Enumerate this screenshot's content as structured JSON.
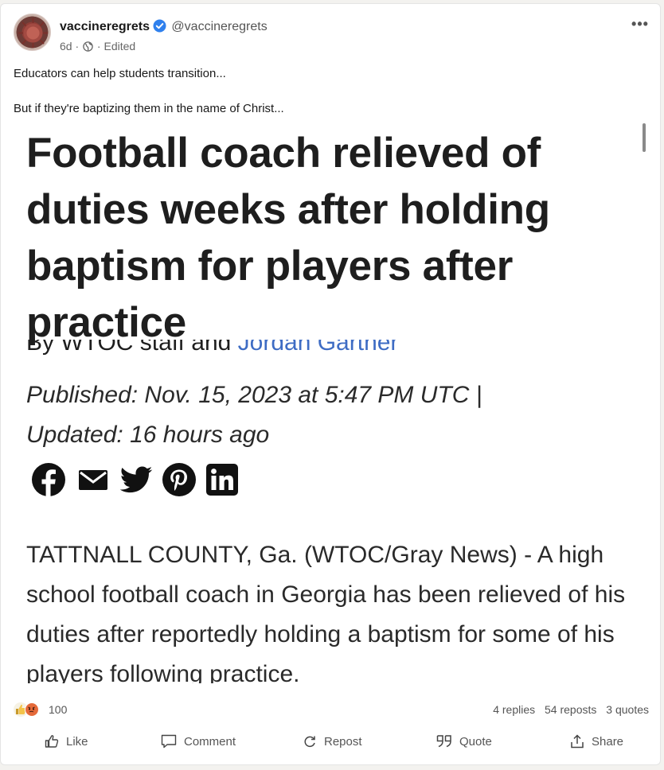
{
  "post": {
    "author_name": "vaccineregrets",
    "handle": "@vaccineregrets",
    "age": "6d",
    "separator": "·",
    "edited": "Edited",
    "more": "•••",
    "text_line1": "Educators can help students transition...",
    "text_line2": "But if they're baptizing them in the name of Christ..."
  },
  "article": {
    "headline": "Football coach relieved of duties weeks after holding baptism for players after practice",
    "byline_prefix": "By WTOC staff and ",
    "byline_author": "Jordan Gartner",
    "published": "Published: Nov. 15, 2023 at 5:47 PM UTC  |",
    "updated": "Updated: 16 hours ago",
    "share_icons": [
      "facebook-icon",
      "email-icon",
      "twitter-icon",
      "pinterest-icon",
      "linkedin-icon"
    ],
    "body": "TATTNALL COUNTY, Ga. (WTOC/Gray News) - A high school football coach in Georgia has been relieved of his duties after reportedly holding a baptism for some of his players following practice."
  },
  "stats": {
    "reaction_count": "100",
    "replies": "4 replies",
    "reposts": "54 reposts",
    "quotes": "3 quotes"
  },
  "actions": {
    "like": "Like",
    "comment": "Comment",
    "repost": "Repost",
    "quote": "Quote",
    "share": "Share"
  },
  "colors": {
    "verified": "#2f80ed",
    "link": "#3e6cc4",
    "angry": "#e56a3a"
  }
}
